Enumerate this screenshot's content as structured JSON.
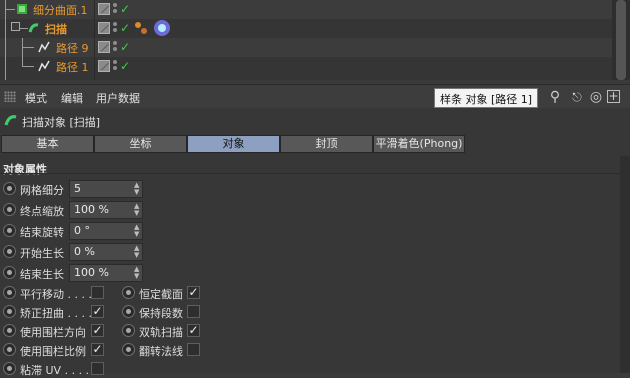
{
  "tree": {
    "rows": [
      {
        "name": "细分曲面.1"
      },
      {
        "name": "扫描"
      },
      {
        "name": "路径 9"
      },
      {
        "name": "路径 1"
      }
    ]
  },
  "menubar": {
    "items": [
      "模式",
      "编辑",
      "用户数据"
    ],
    "tooltip": "样条 对象 [路径 1]"
  },
  "object_header": {
    "title": "扫描对象 [扫描]"
  },
  "tabs": [
    "基本",
    "坐标",
    "对象",
    "封顶",
    "平滑着色(Phong)"
  ],
  "active_tab": "对象",
  "group": {
    "title": "对象属性"
  },
  "fields": [
    {
      "label": "网格细分",
      "value": "5"
    },
    {
      "label": "终点缩放",
      "value": "100 %"
    },
    {
      "label": "结束旋转",
      "value": "0 °"
    },
    {
      "label": "开始生长",
      "value": "0 %"
    },
    {
      "label": "结束生长",
      "value": "100 %"
    }
  ],
  "checkboxes_left": [
    {
      "label": "平行移动",
      "dots": ". . . .",
      "checked": false
    },
    {
      "label": "矫正扭曲",
      "dots": ". . . .",
      "checked": true
    },
    {
      "label": "使用围栏方向",
      "dots": "",
      "checked": true
    },
    {
      "label": "使用围栏比例",
      "dots": "",
      "checked": true
    },
    {
      "label": "粘滞 UV",
      "dots": ". . . . .",
      "checked": false
    }
  ],
  "checkboxes_right": [
    {
      "label": "恒定截面",
      "checked": true
    },
    {
      "label": "保持段数",
      "checked": false
    },
    {
      "label": "双轨扫描",
      "checked": true
    },
    {
      "label": "翻转法线",
      "checked": false
    }
  ],
  "check_mark": "✓",
  "colors": {
    "accent": "#8ea0c2",
    "object_name": "#e89a2f",
    "enabled_check": "#3fce3f"
  }
}
